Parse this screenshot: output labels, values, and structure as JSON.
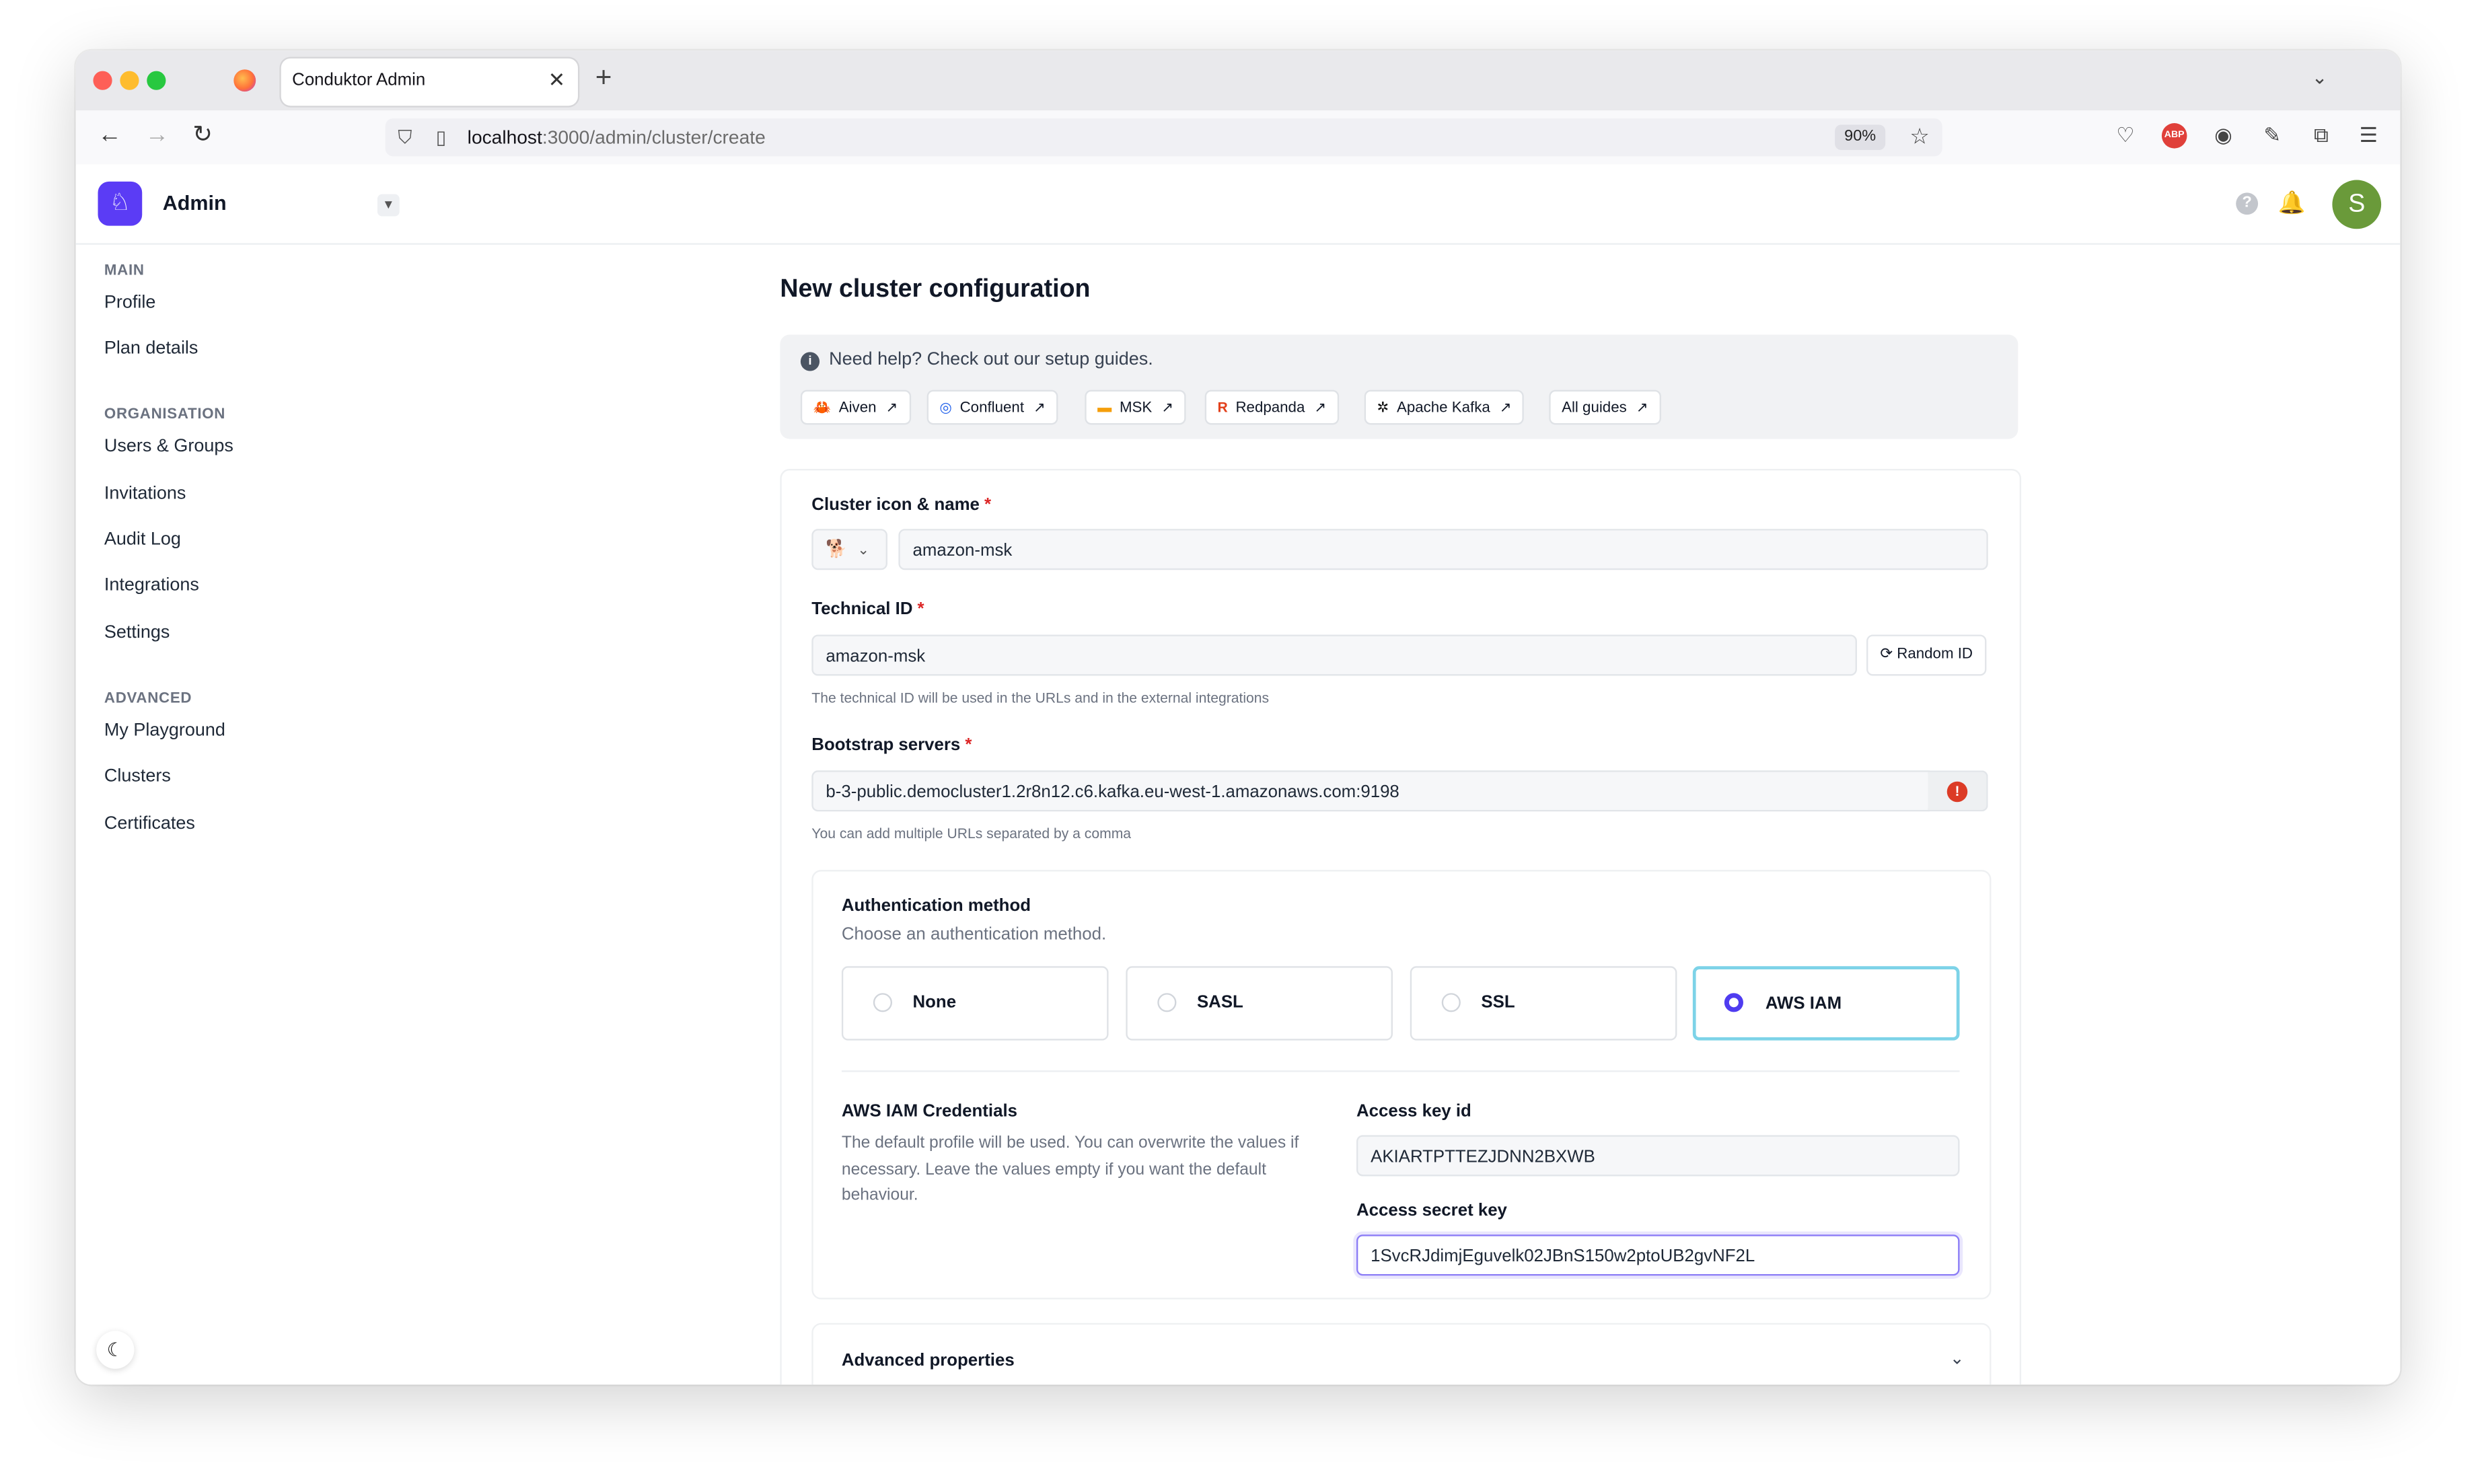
{
  "browser": {
    "tab_title": "Conduktor Admin",
    "url_host": "localhost",
    "url_path": ":3000/admin/cluster/create",
    "zoom": "90%"
  },
  "app": {
    "title": "Admin",
    "avatar_initial": "S",
    "brand_color": "#5b3cf5"
  },
  "sidebar": {
    "sections": [
      {
        "title": "MAIN",
        "items": [
          "Profile",
          "Plan details"
        ]
      },
      {
        "title": "ORGANISATION",
        "items": [
          "Users & Groups",
          "Invitations",
          "Audit Log",
          "Integrations",
          "Settings"
        ]
      },
      {
        "title": "ADVANCED",
        "items": [
          "My Playground",
          "Clusters",
          "Certificates"
        ]
      }
    ]
  },
  "page": {
    "title": "New cluster configuration",
    "help_text": "Need help? Check out our setup guides.",
    "guides": [
      "Aiven",
      "Confluent",
      "MSK",
      "Redpanda",
      "Apache Kafka",
      "All guides"
    ]
  },
  "form": {
    "cluster_name_label": "Cluster icon & name",
    "cluster_name_value": "amazon-msk",
    "technical_id_label": "Technical ID",
    "technical_id_value": "amazon-msk",
    "random_id_label": "Random ID",
    "technical_id_hint": "The technical ID will be used in the URLs and in the external integrations",
    "bootstrap_label": "Bootstrap servers",
    "bootstrap_value": "b-3-public.democluster1.2r8n12.c6.kafka.eu-west-1.amazonaws.com:9198",
    "bootstrap_hint": "You can add multiple URLs separated by a comma",
    "required_mark": "*"
  },
  "auth": {
    "title": "Authentication method",
    "subtitle": "Choose an authentication method.",
    "options": [
      "None",
      "SASL",
      "SSL",
      "AWS IAM"
    ],
    "selected": "AWS IAM",
    "cred_title": "AWS IAM Credentials",
    "cred_desc": "The default profile will be used. You can overwrite the values if necessary. Leave the values empty if you want the default behaviour.",
    "access_key_label": "Access key id",
    "access_key_value": "AKIARTPTTEZJDNN2BXWB",
    "secret_key_label": "Access secret key",
    "secret_key_value": "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"
  },
  "advanced": {
    "title": "Advanced properties"
  }
}
